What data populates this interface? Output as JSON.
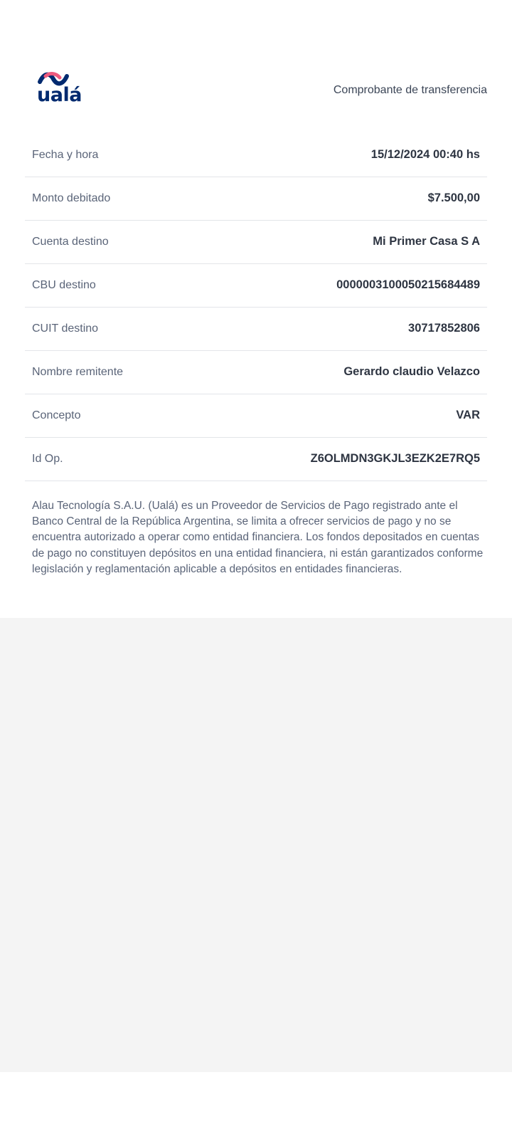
{
  "brand": {
    "logo_text": "ualá",
    "logo_colors": {
      "wave_pink": "#ee5b7e",
      "wave_blue": "#022a6f",
      "text": "#022a6f"
    },
    "logo_icon": "wave-icon"
  },
  "header": {
    "title": "Comprobante de transferencia"
  },
  "details": [
    {
      "label": "Fecha y hora",
      "value": "15/12/2024 00:40 hs"
    },
    {
      "label": "Monto debitado",
      "value": "$7.500,00"
    },
    {
      "label": "Cuenta destino",
      "value": "Mi Primer Casa S A"
    },
    {
      "label": "CBU destino",
      "value": "0000003100050215684489"
    },
    {
      "label": "CUIT destino",
      "value": "30717852806"
    },
    {
      "label": "Nombre remitente",
      "value": "Gerardo claudio Velazco"
    },
    {
      "label": "Concepto",
      "value": "VAR"
    },
    {
      "label": "Id Op.",
      "value": "Z6OLMDN3GKJL3EZK2E7RQ5"
    }
  ],
  "disclaimer": "Alau Tecnología S.A.U. (Ualá) es un Proveedor de Servicios de Pago registrado ante el Banco Central de la República Argentina, se limita a ofrecer servicios de pago y no se encuentra autorizado a operar como entidad financiera. Los fondos depositados en cuentas de pago no constituyen depósitos en una entidad financiera, ni están garantizados conforme legislación y reglamentación aplicable a depósitos en entidades financieras.",
  "colors": {
    "background": "#ffffff",
    "lower_background": "#f4f4f4",
    "divider": "#e3e5e9",
    "label_text": "#5a6478",
    "value_text": "#2e3542"
  }
}
